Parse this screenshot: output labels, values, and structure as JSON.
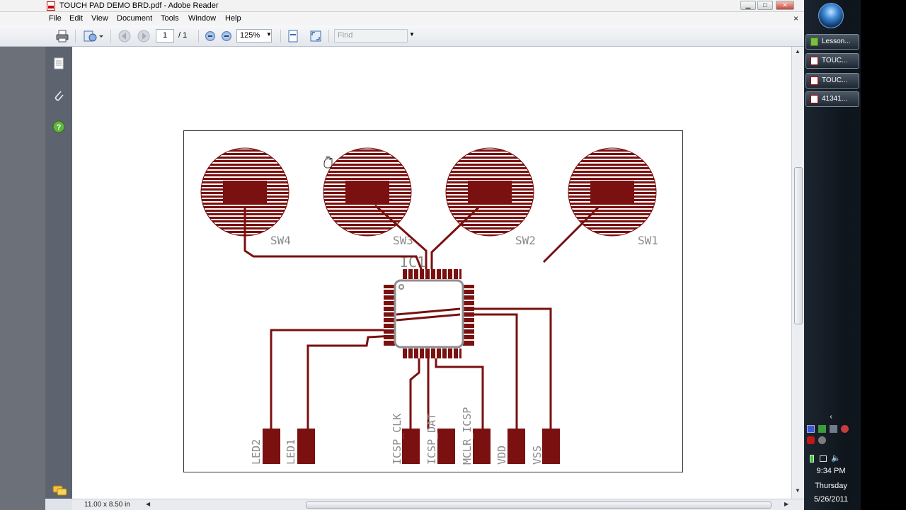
{
  "window": {
    "title": "TOUCH PAD DEMO BRD.pdf - Adobe Reader",
    "min": "▁",
    "max": "□",
    "close": "✕"
  },
  "menu": [
    "File",
    "Edit",
    "View",
    "Document",
    "Tools",
    "Window",
    "Help"
  ],
  "menu_close": "×",
  "toolbar": {
    "page_current": "1",
    "page_total": "/ 1",
    "zoom": "125%",
    "find_placeholder": "Find"
  },
  "status": {
    "page_size": "11.00 x 8.50 in"
  },
  "board": {
    "switches": [
      "SW4",
      "SW3",
      "SW2",
      "SW1"
    ],
    "ic_label": "IC1",
    "pads": [
      "LED2",
      "LED1",
      "ICSP_CLK",
      "ICSP_DAT",
      "MCLR_ICSP",
      "VDD",
      "VSS"
    ],
    "color": "#7a1010"
  },
  "taskbar": {
    "items": [
      {
        "label": "Lesson...",
        "icon": "lesson-icon"
      },
      {
        "label": "TOUC...",
        "icon": "pdf-icon"
      },
      {
        "label": "TOUC...",
        "icon": "pdf-icon"
      },
      {
        "label": "41341...",
        "icon": "pdf-icon"
      }
    ],
    "time": "9:34 PM",
    "day": "Thursday",
    "date": "5/26/2011"
  }
}
